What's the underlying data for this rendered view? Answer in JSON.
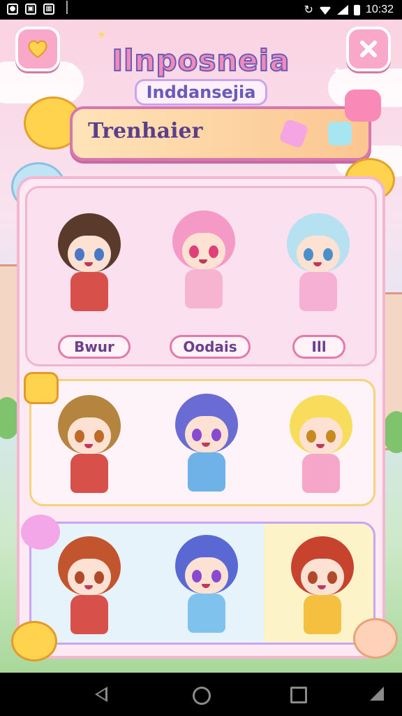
{
  "status_bar": {
    "time": "10:32",
    "left_icons": [
      "notification-icon-1",
      "notification-icon-2",
      "notification-icon-3",
      "notification-icon-4"
    ]
  },
  "header": {
    "title": "Ilnposneia",
    "subtitle": "Inddansejia",
    "left_button_icon": "heart-icon",
    "right_button_icon": "close-icon"
  },
  "banner": {
    "label": "Trenhaier"
  },
  "rows": [
    {
      "characters": [
        {
          "name": "Bwur",
          "hair": "#5a3a2a",
          "eyes": "#4a78c8",
          "outfit": "#d8504a"
        },
        {
          "name": "Oodais",
          "hair": "#f59ac6",
          "eyes": "#e0407a",
          "outfit": "#f7b4d0"
        },
        {
          "name": "Ill",
          "hair": "#b6e1f0",
          "eyes": "#4a8fc8",
          "outfit": "#f6b0d4"
        }
      ]
    },
    {
      "characters": [
        {
          "name": "",
          "hair": "#b5853f",
          "eyes": "#c06a2a",
          "outfit": "#d8504a"
        },
        {
          "name": "",
          "hair": "#6a6cd4",
          "eyes": "#8a4ad0",
          "outfit": "#6fb2e8"
        },
        {
          "name": "",
          "hair": "#f8dd5c",
          "eyes": "#c88a20",
          "outfit": "#f6a6c8"
        }
      ]
    },
    {
      "characters": [
        {
          "name": "",
          "hair": "#c2552e",
          "eyes": "#b04a2a",
          "outfit": "#d8504a"
        },
        {
          "name": "",
          "hair": "#5a68d4",
          "eyes": "#8a4ad0",
          "outfit": "#7fc2ee"
        },
        {
          "name": "",
          "hair": "#c8432e",
          "eyes": "#b04a2a",
          "outfit": "#f5bf3f"
        }
      ]
    }
  ],
  "colors": {
    "accent": "#f08ab8",
    "panel": "#fde9f3",
    "banner": "#fbc690"
  }
}
